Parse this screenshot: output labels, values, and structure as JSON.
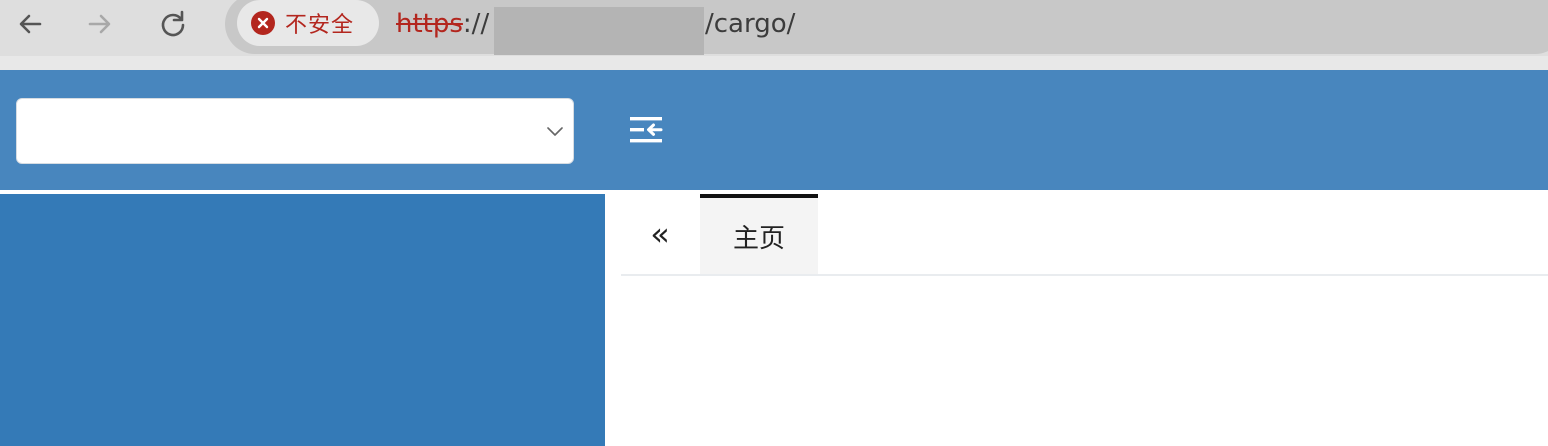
{
  "browser": {
    "security_label": "不安全",
    "url": {
      "scheme": "https",
      "separator": "://",
      "path_visible": "/cargo/"
    },
    "icons": {
      "back": "arrow-left-icon",
      "forward": "arrow-right-icon",
      "reload": "reload-icon",
      "security": "warning-circle-icon"
    },
    "colors": {
      "insecure": "#b3261e"
    }
  },
  "header": {
    "select_value": "",
    "menu_toggle_icon": "menu-collapse-icon",
    "background": "#4886be"
  },
  "sidebar": {
    "background": "#347ab7"
  },
  "tabs": {
    "scroll_left_label": "«",
    "items": [
      {
        "label": "主页",
        "active": true
      }
    ]
  }
}
